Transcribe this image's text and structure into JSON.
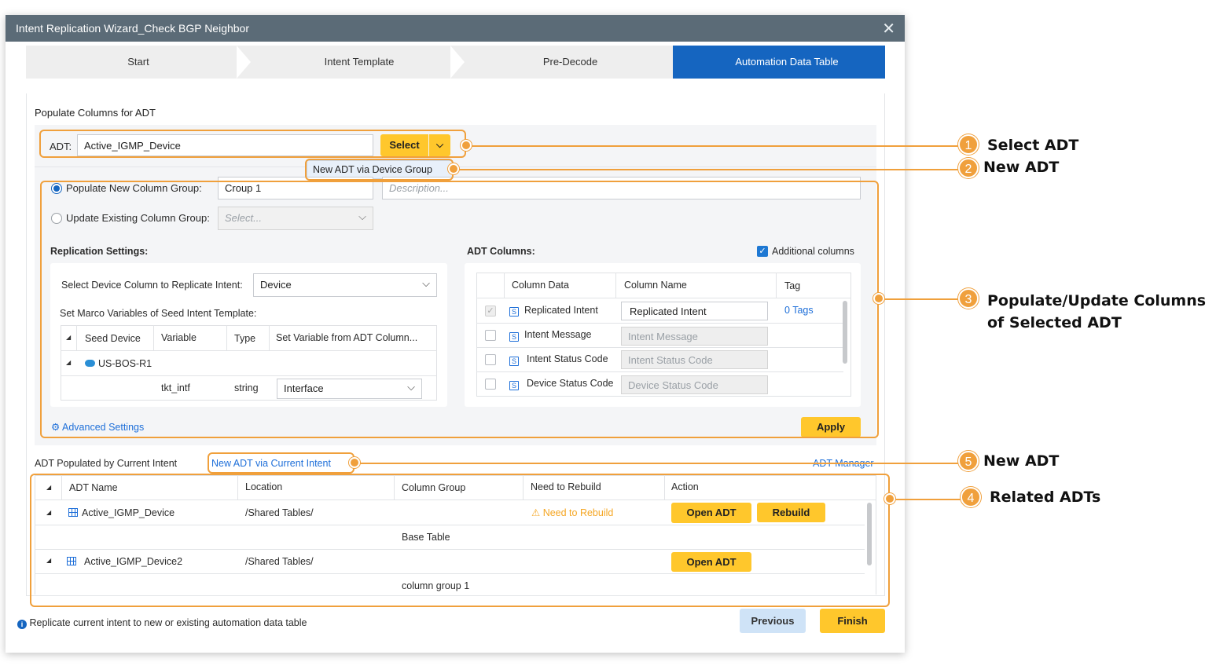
{
  "dialog": {
    "title": "Intent Replication Wizard_Check BGP Neighbor",
    "close_glyph": "✕"
  },
  "steps": [
    {
      "label": "Start",
      "active": false
    },
    {
      "label": "Intent Template",
      "active": false
    },
    {
      "label": "Pre-Decode",
      "active": false
    },
    {
      "label": "Automation Data Table",
      "active": true
    }
  ],
  "populate": {
    "section_title": "Populate Columns for ADT",
    "adt_label": "ADT:",
    "adt_value": "Active_IGMP_Device",
    "select_button": "Select",
    "dropdown_item": "New ADT via Device Group",
    "populate_new_label": "Populate New Column Group:",
    "populate_new_value": "Croup 1",
    "description_placeholder": "Description...",
    "update_existing_label": "Update Existing Column Group:",
    "update_existing_placeholder": "Select..."
  },
  "replication": {
    "title": "Replication Settings:",
    "device_column_label": "Select Device Column to Replicate Intent:",
    "device_column_value": "Device",
    "macro_label": "Set Marco Variables of Seed Intent Template:",
    "columns": [
      "Seed Device",
      "Variable",
      "Type",
      "Set Variable from ADT Column..."
    ],
    "device_name": "US-BOS-R1",
    "var_row": {
      "variable": "tkt_intf",
      "type": "string",
      "adt_column": "Interface"
    }
  },
  "adt_columns": {
    "title": "ADT Columns:",
    "additional_label": "Additional columns",
    "headers": [
      "Column Data",
      "Column Name",
      "Tag"
    ],
    "rows": [
      {
        "data": "Replicated Intent",
        "name": "Replicated Intent",
        "tag": "0 Tags"
      },
      {
        "data": "Intent Message",
        "name": "Intent Message",
        "tag": ""
      },
      {
        "data": "Intent Status Code",
        "name": "Intent Status Code",
        "tag": ""
      },
      {
        "data": "Device Status Code",
        "name": "Device Status Code",
        "tag": ""
      }
    ],
    "s_glyph": "S"
  },
  "advanced_settings": "Advanced Settings",
  "apply_button": "Apply",
  "related": {
    "title": "ADT Populated by Current Intent",
    "new_link": "New ADT via Current Intent",
    "manager_link": "ADT Manager",
    "headers": [
      "ADT Name",
      "Location",
      "Column Group",
      "Need to Rebuild",
      "Action"
    ],
    "rows": [
      {
        "name": "Active_IGMP_Device",
        "location": "/Shared Tables/",
        "rebuild": "Need to Rebuild",
        "sub": "Base Table",
        "open": "Open ADT",
        "rebuild_btn": "Rebuild"
      },
      {
        "name": "Active_IGMP_Device2",
        "location": "/Shared Tables/",
        "rebuild": "",
        "sub": "column group 1",
        "open": "Open ADT",
        "rebuild_btn": ""
      }
    ]
  },
  "footer": {
    "info_text": "Replicate current intent to new or existing automation data table",
    "previous": "Previous",
    "finish": "Finish"
  },
  "callouts": [
    {
      "num": "1",
      "text": "Select ADT"
    },
    {
      "num": "2",
      "text": "New ADT"
    },
    {
      "num": "3",
      "text": "Populate/Update Columns",
      "text2": "of Selected ADT"
    },
    {
      "num": "5",
      "text": "New ADT"
    },
    {
      "num": "4",
      "text": "Related ADTs"
    }
  ],
  "colors": {
    "accent": "#1565c0",
    "highlight": "#f0a03c",
    "button": "#ffc72c",
    "warning": "#f5a623"
  }
}
